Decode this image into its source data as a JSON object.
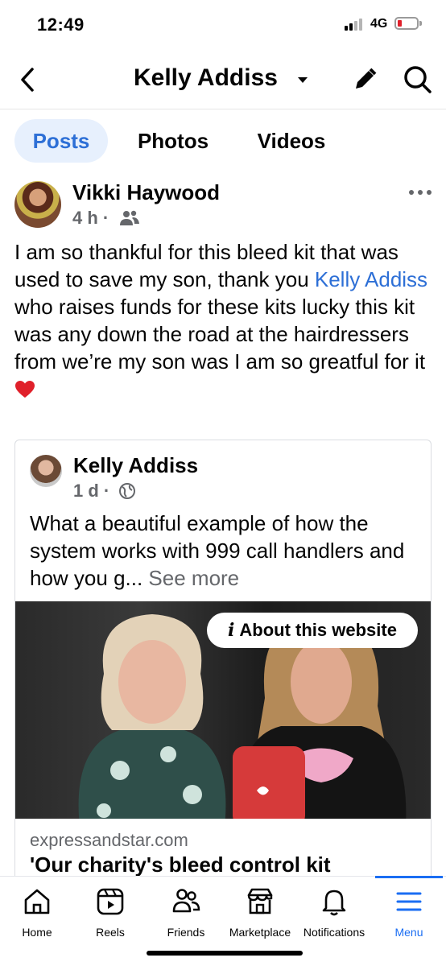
{
  "status": {
    "time": "12:49",
    "network": "4G"
  },
  "header": {
    "title": "Kelly Addiss"
  },
  "tabs": [
    {
      "label": "Posts",
      "active": true
    },
    {
      "label": "Photos",
      "active": false
    },
    {
      "label": "Videos",
      "active": false
    }
  ],
  "post": {
    "author": "Vikki Haywood",
    "time": "4 h",
    "audience_icon": "friends-icon",
    "text_before": "I am so thankful for this bleed kit that was used to save my son, thank you ",
    "mention": "Kelly Addiss",
    "text_after": " who raises funds for these kits lucky this kit was any down the road at the hairdressers from we’re my son was I am so greatful for it",
    "shared": {
      "author": "Kelly Addiss",
      "time": "1 d",
      "audience_icon": "globe-icon",
      "text": "What a beautiful example of how the system works with 999 call handlers and how you g... ",
      "see_more": "See more",
      "about_label": "About this website",
      "link_domain": "expressandstar.com",
      "link_title": "'Our charity's bleed control kit"
    }
  },
  "bottom_nav": [
    {
      "label": "Home",
      "icon": "home-icon"
    },
    {
      "label": "Reels",
      "icon": "reels-icon"
    },
    {
      "label": "Friends",
      "icon": "friends-icon"
    },
    {
      "label": "Marketplace",
      "icon": "marketplace-icon"
    },
    {
      "label": "Notifications",
      "icon": "bell-icon"
    },
    {
      "label": "Menu",
      "icon": "menu-icon",
      "active": true
    }
  ],
  "colors": {
    "accent": "#1b6ef3",
    "mention": "#2d6fd6",
    "muted": "#65676b"
  }
}
